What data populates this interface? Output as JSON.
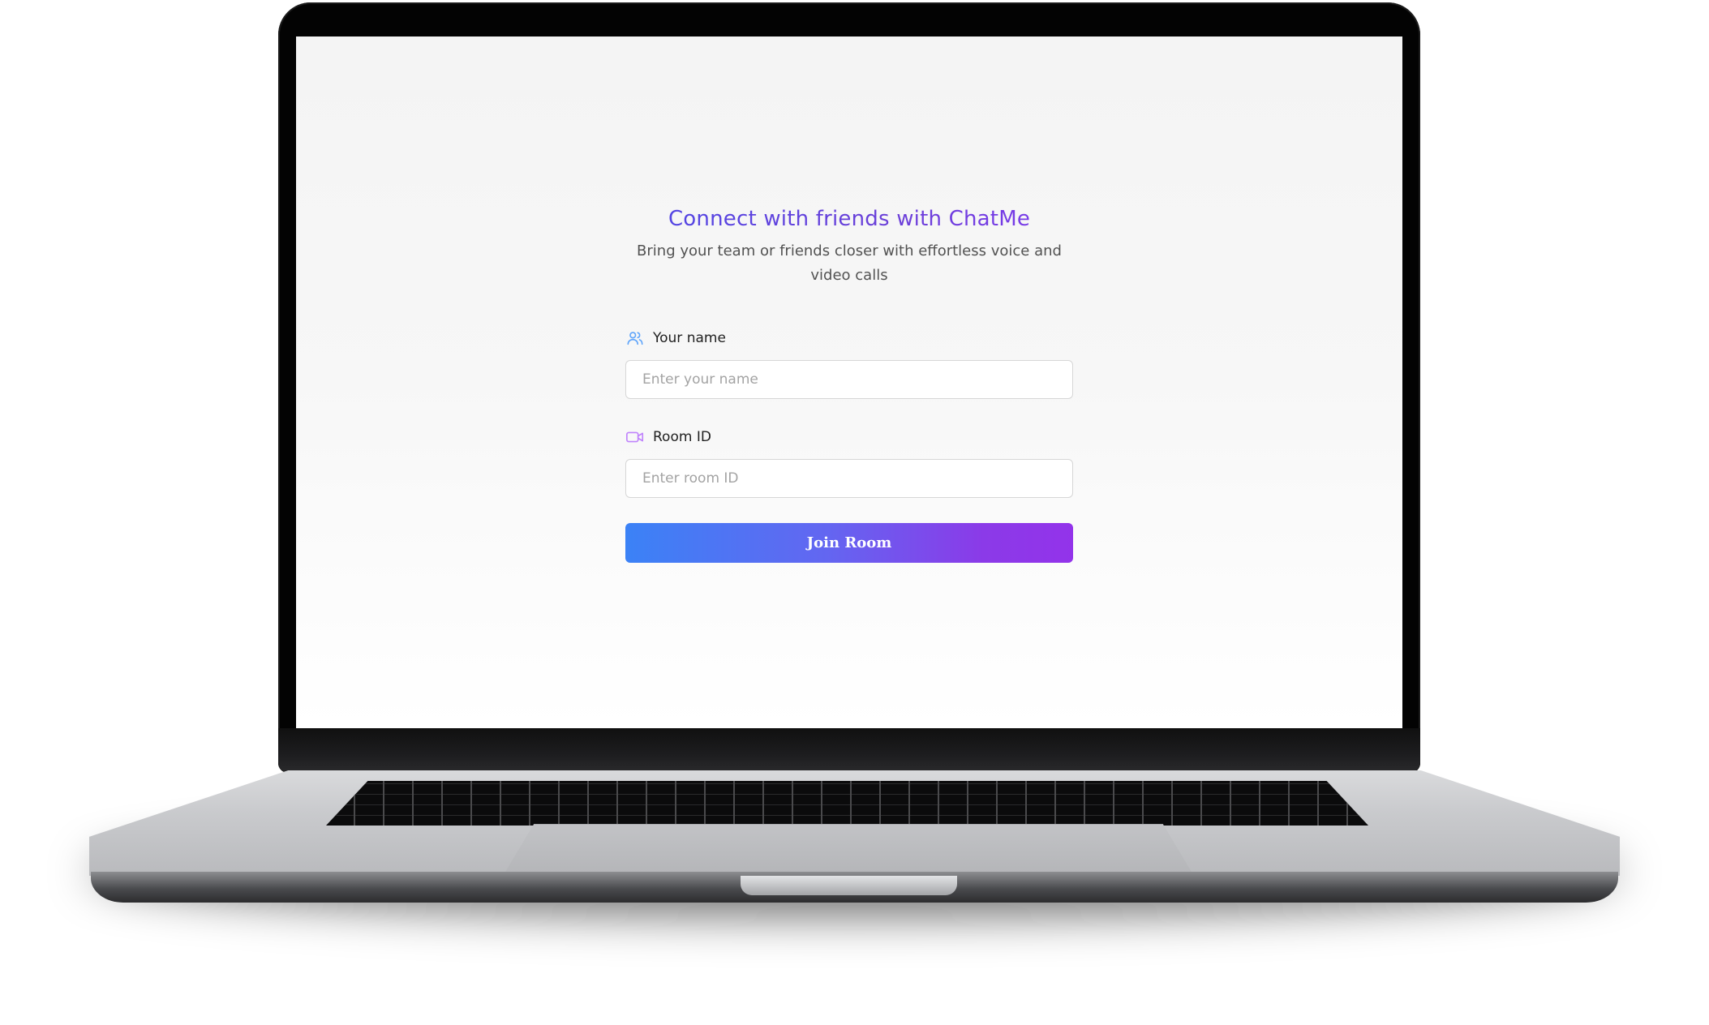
{
  "app": {
    "title": "Connect with friends with ChatMe",
    "subtitle": "Bring your team or friends closer with effortless voice and video calls"
  },
  "form": {
    "name_field": {
      "label": "Your name",
      "placeholder": "Enter your name",
      "value": "",
      "icon": "users-icon",
      "icon_color": "#60a5fa"
    },
    "room_field": {
      "label": "Room ID",
      "placeholder": "Enter room ID",
      "value": "",
      "icon": "video-camera-icon",
      "icon_color": "#c084fc"
    },
    "join_button_label": "Join Room"
  },
  "colors": {
    "title_gradient": [
      "#4f46e5",
      "#7c3aed"
    ],
    "button_gradient": [
      "#3b82f6",
      "#9333ea"
    ],
    "screen_background": "#f5f5f5"
  }
}
